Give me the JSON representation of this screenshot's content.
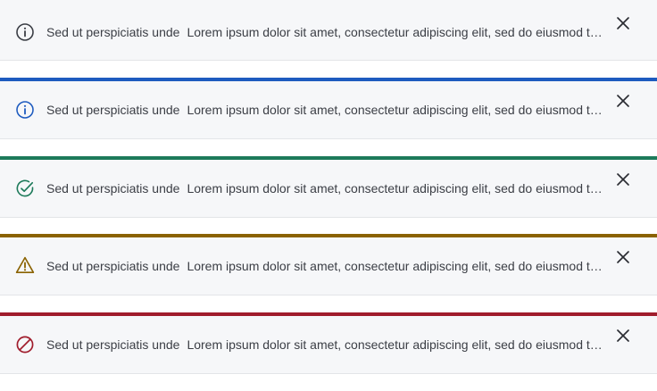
{
  "banners": [
    {
      "variant": "neutral",
      "icon": "info-icon",
      "accent": "",
      "icon_color": "#3b3e45",
      "title": "Sed ut perspiciatis unde",
      "message": "Lorem ipsum dolor sit amet, consectetur adipiscing elit, sed do eiusmod tempor incididunt ut labore et dolore magna aliqua."
    },
    {
      "variant": "info",
      "icon": "info-icon",
      "accent": "#1e5bbf",
      "icon_color": "#1e5bbf",
      "title": "Sed ut perspiciatis unde",
      "message": "Lorem ipsum dolor sit amet, consectetur adipiscing elit, sed do eiusmod tempor incididunt ut labore et dolore magna aliqua."
    },
    {
      "variant": "success",
      "icon": "check-circle-icon",
      "accent": "#1d7a5a",
      "icon_color": "#1d7a5a",
      "title": "Sed ut perspiciatis unde",
      "message": "Lorem ipsum dolor sit amet, consectetur adipiscing elit, sed do eiusmod tempor incididunt ut labore et dolore magna aliqua."
    },
    {
      "variant": "warning",
      "icon": "warning-icon",
      "accent": "#8a6200",
      "icon_color": "#8a6200",
      "title": "Sed ut perspiciatis unde",
      "message": "Lorem ipsum dolor sit amet, consectetur adipiscing elit, sed do eiusmod tempor incididunt ut labore et dolore magna aliqua."
    },
    {
      "variant": "error",
      "icon": "error-icon",
      "accent": "#a01c2c",
      "icon_color": "#a01c2c",
      "title": "Sed ut perspiciatis unde",
      "message": "Lorem ipsum dolor sit amet, consectetur adipiscing elit, sed do eiusmod tempor incididunt ut labore et dolore magna aliqua."
    }
  ],
  "close_icon": "close-icon",
  "close_color": "#2b2d33"
}
